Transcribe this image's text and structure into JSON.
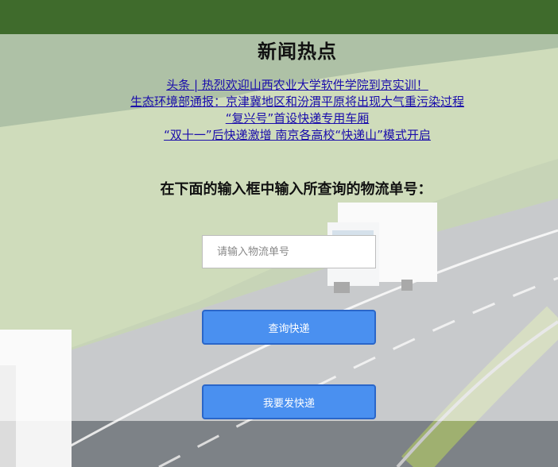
{
  "page": {
    "title": "新闻热点",
    "prompt": "在下面的输入框中输入所查询的物流单号："
  },
  "news": [
    "头条 | 热烈欢迎山西农业大学软件学院到京实训！",
    "生态环境部通报：京津冀地区和汾渭平原将出现大气重污染过程",
    "“复兴号”首设快递专用车厢",
    "“双十一”后快递激增 南京各高校“快递山”模式开启"
  ],
  "search": {
    "placeholder": "请输入物流单号",
    "value": ""
  },
  "buttons": {
    "query_label": "查询快递",
    "send_label": "我要发快递"
  },
  "colors": {
    "button_bg": "#4a90f0",
    "button_border": "#2a66c9",
    "link": "#1a0dab"
  }
}
